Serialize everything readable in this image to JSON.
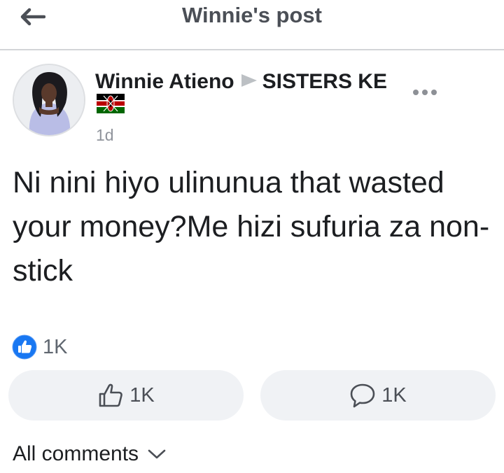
{
  "header": {
    "title": "Winnie's post",
    "back_icon": "arrow-left-icon"
  },
  "post": {
    "author": "Winnie Atieno",
    "group": "SISTERS KE",
    "group_flag": "kenya-flag-icon",
    "timestamp": "1d",
    "body": "Ni nini hiyo ulinunua that wasted your money?Me hizi sufuria za non-stick",
    "more_icon": "more-horizontal-icon"
  },
  "reactions": {
    "icon": "like-reaction-icon",
    "count": "1K"
  },
  "actions": {
    "like_count": "1K",
    "comment_count": "1K"
  },
  "comments": {
    "filter_label": "All comments"
  },
  "colors": {
    "like_blue": "#1877f2",
    "pill_bg": "#f0f2f5",
    "secondary_text": "#606770"
  }
}
